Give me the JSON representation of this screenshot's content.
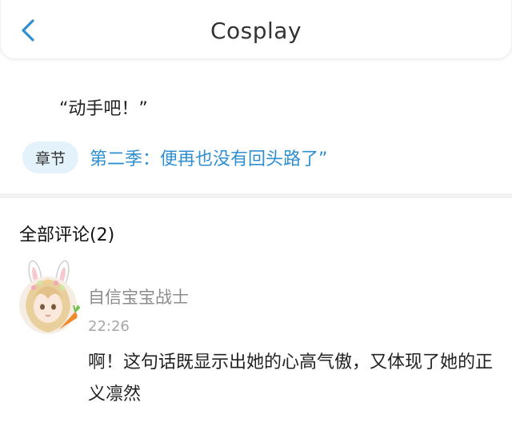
{
  "header": {
    "title": "Cosplay",
    "back_icon": "chevron-left-icon",
    "accent_color": "#2f8fd0"
  },
  "post": {
    "quote": "“动手吧！”",
    "chapter_badge": "章节",
    "chapter_title": "第二季：便再也没有回头路了”"
  },
  "comments": {
    "header": "全部评论(2)",
    "items": [
      {
        "author": "自信宝宝战士",
        "time": "22:26",
        "text": "啊！这句话既显示出她的心高气傲，又体现了她的正义凛然",
        "avatar_icon": "bunny-girl-avatar"
      }
    ]
  }
}
